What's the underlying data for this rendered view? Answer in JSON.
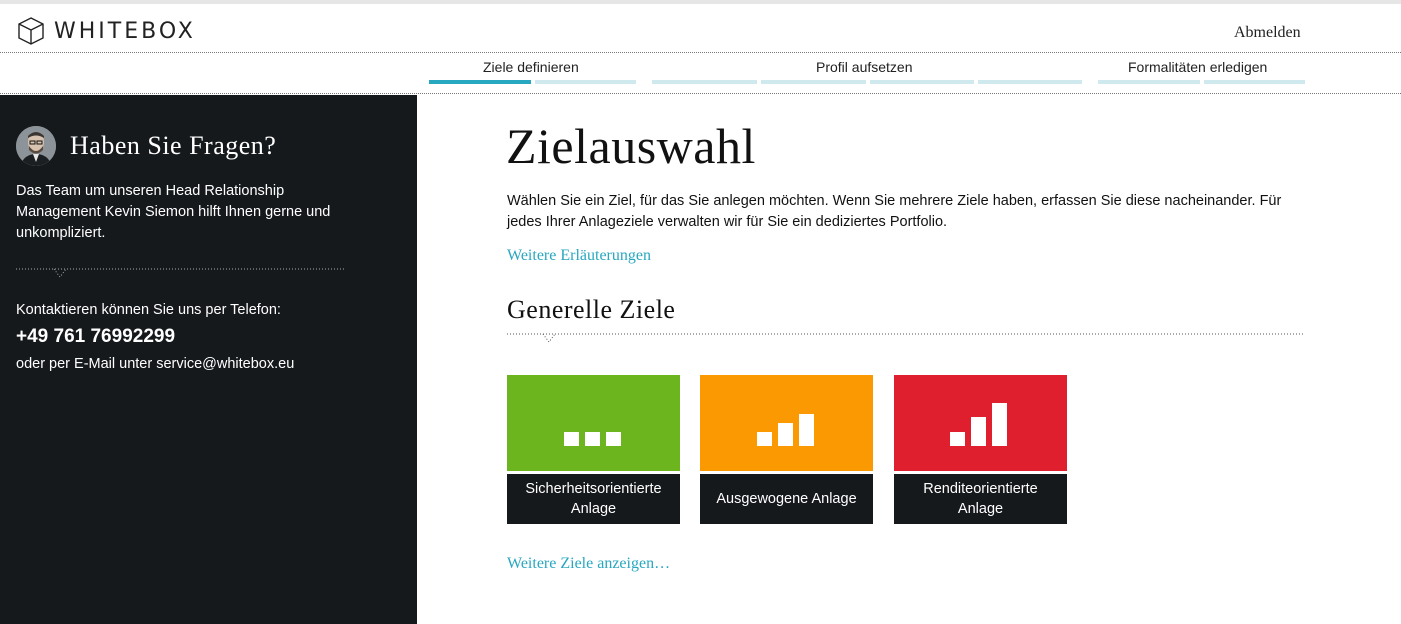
{
  "header": {
    "logo_text": "WHITEBOX",
    "logout_label": "Abmelden"
  },
  "steps": [
    {
      "label": "Ziele definieren",
      "active": true
    },
    {
      "label": "Profil aufsetzen",
      "active": false
    },
    {
      "label": "Formalitäten erledigen",
      "active": false
    }
  ],
  "sidebar": {
    "title": "Haben Sie Fragen?",
    "text": "Das Team um unseren Head Relationship Management Kevin Siemon hilft Ihnen gerne und unkompliziert.",
    "contact_label": "Kontaktieren können Sie uns per Telefon:",
    "phone": "+49 761 76992299",
    "email_line": "oder per E-Mail unter service@whitebox.eu"
  },
  "main": {
    "title": "Zielauswahl",
    "intro": "Wählen Sie ein Ziel, für das Sie anlegen möchten. Wenn Sie mehrere Ziele haben, erfassen Sie diese nacheinander. Für jedes Ihrer Anlageziele verwalten wir für Sie ein dediziertes Portfolio.",
    "more_info_link": "Weitere Erläuterungen",
    "section_title": "Generelle Ziele",
    "tiles": [
      {
        "label": "Sicherheitsorientierte Anlage",
        "color": "#6db51f",
        "icon": "flat-bars-icon"
      },
      {
        "label": "Ausgewogene Anlage",
        "color": "#fb9902",
        "icon": "medium-bars-icon"
      },
      {
        "label": "Renditeorientierte Anlage",
        "color": "#df1f2d",
        "icon": "rising-bars-icon"
      }
    ],
    "more_goals_link": "Weitere Ziele anzeigen…"
  },
  "colors": {
    "accent": "#28a7c0",
    "sidebar_bg": "#15191c",
    "step_inactive": "#cfe9ee"
  }
}
